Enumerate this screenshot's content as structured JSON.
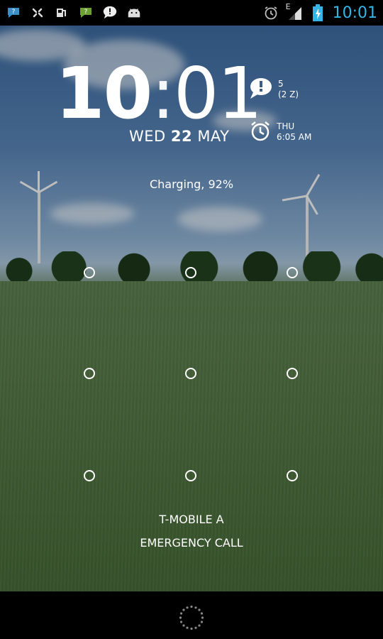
{
  "status_bar": {
    "left_icons": [
      "chat-notification-icon",
      "settings-icon",
      "gas-station-icon",
      "chat-notification-green-icon",
      "speech-bubble-icon",
      "android-icon"
    ],
    "network_label": "E",
    "time": "10:01",
    "accent_color": "#33b5e5"
  },
  "lockscreen": {
    "clock_hours": "10",
    "clock_sep": ":",
    "clock_minutes": "01",
    "date_day": "WED",
    "date_num": "22",
    "date_month": "MAY",
    "notification_count": "5",
    "notification_sub": "(2 Z)",
    "alarm_day": "THU",
    "alarm_time": "6:05 AM",
    "charging": "Charging, 92%",
    "carrier": "T-MOBILE A",
    "emergency_call": "EMERGENCY CALL"
  }
}
